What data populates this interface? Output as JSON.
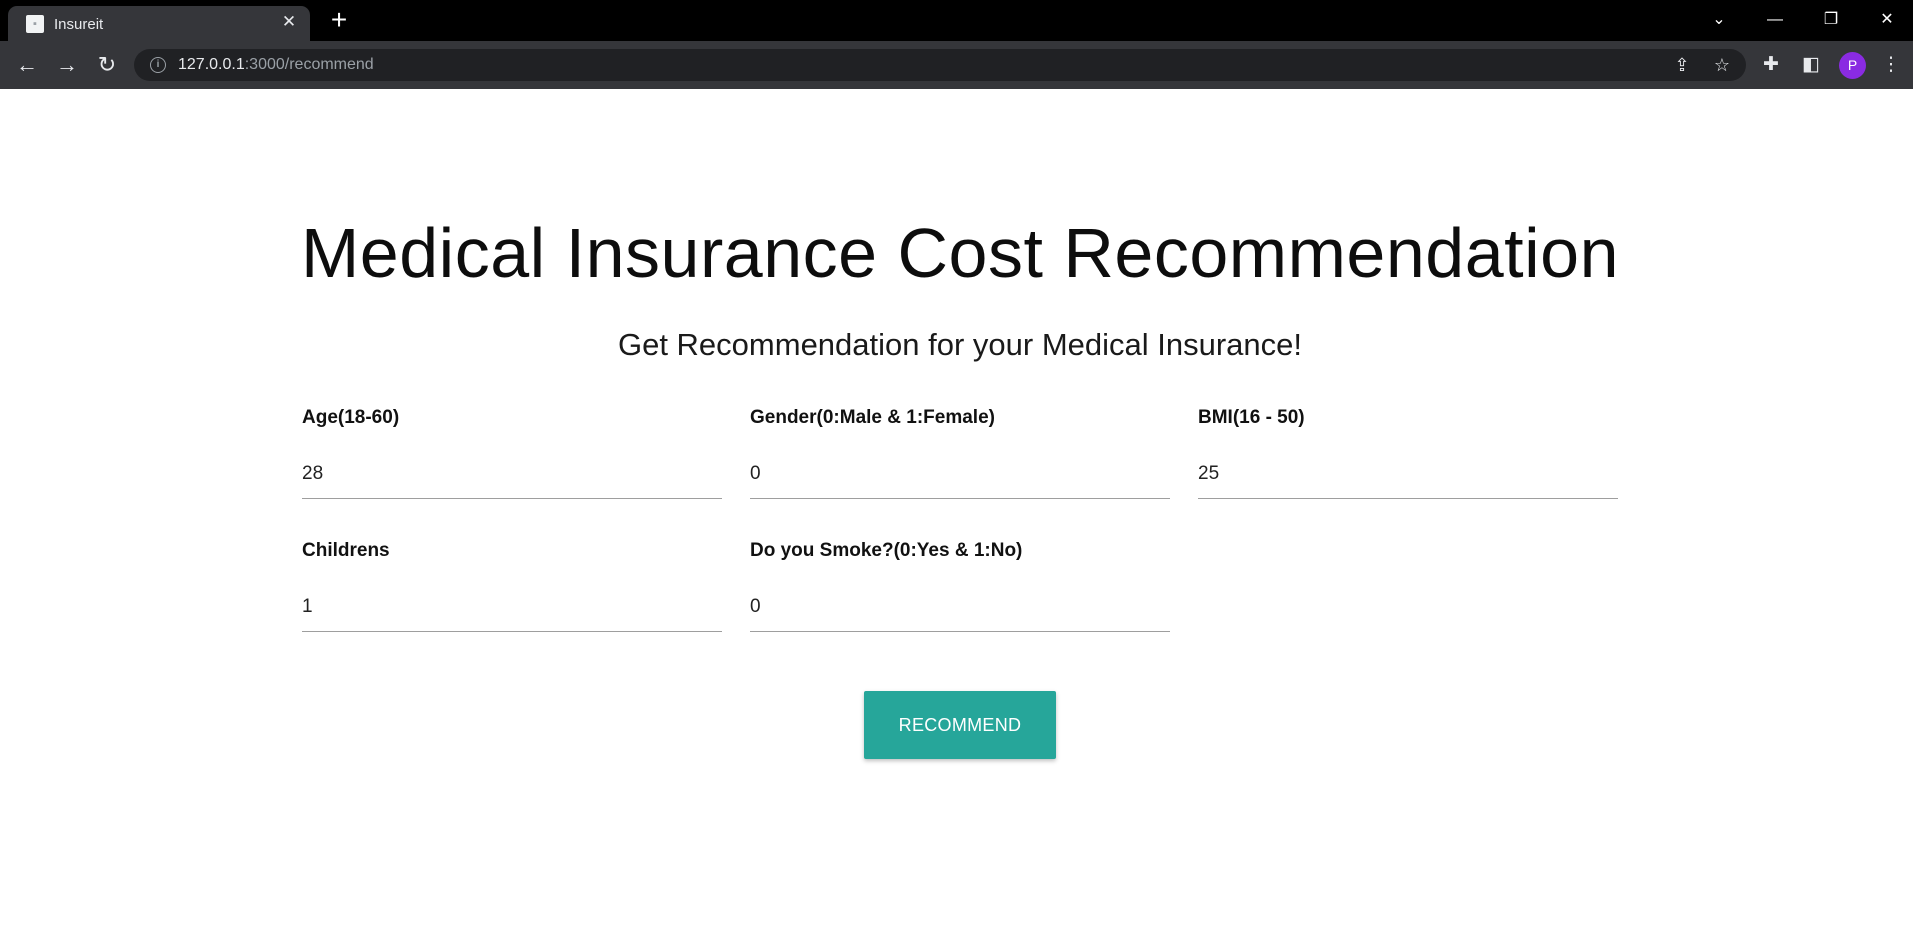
{
  "browser": {
    "tab_title": "Insureit",
    "url_host": "127.0.0.1",
    "url_rest": ":3000/recommend",
    "profile_initial": "P"
  },
  "page": {
    "title": "Medical Insurance Cost Recommendation",
    "subtitle": "Get Recommendation for your Medical Insurance!",
    "fields": [
      {
        "label": "Age(18-60)",
        "value": "28"
      },
      {
        "label": "Gender(0:Male & 1:Female)",
        "value": "0"
      },
      {
        "label": "BMI(16 - 50)",
        "value": "25"
      },
      {
        "label": "Childrens",
        "value": "1"
      },
      {
        "label": "Do you Smoke?(0:Yes & 1:No)",
        "value": "0"
      }
    ],
    "button_label": "RECOMMEND",
    "accent_color": "#26a69a"
  }
}
